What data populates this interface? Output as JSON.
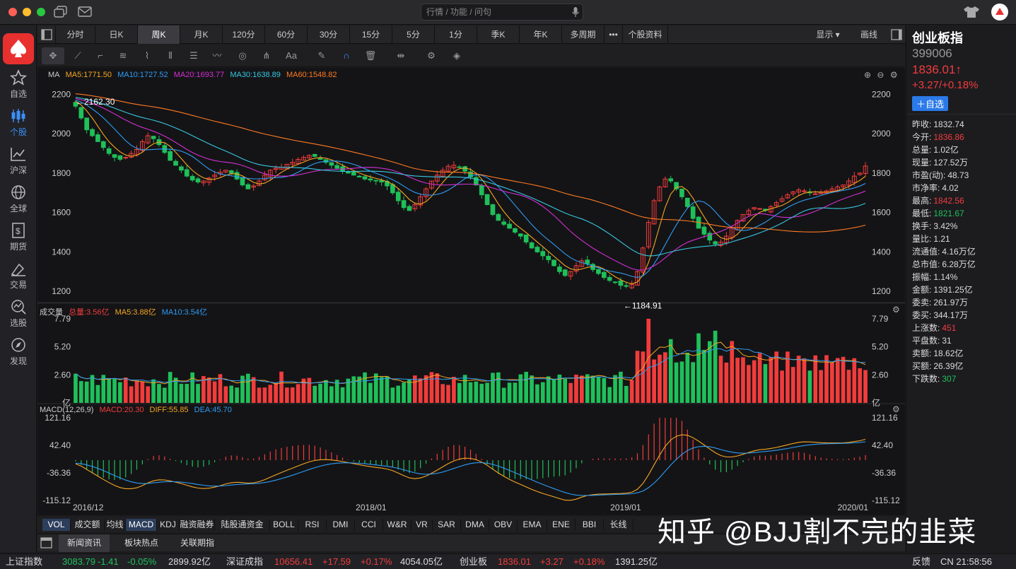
{
  "titlebar": {
    "search_placeholder": "行情 / 功能 / 问句"
  },
  "nav": [
    {
      "label": "自选",
      "icon": "star-icon"
    },
    {
      "label": "个股",
      "icon": "candlestick-icon",
      "active": true
    },
    {
      "label": "沪深",
      "icon": "line-chart-icon"
    },
    {
      "label": "全球",
      "icon": "globe-icon"
    },
    {
      "label": "期货",
      "icon": "futures-icon"
    },
    {
      "label": "交易",
      "icon": "trade-icon"
    },
    {
      "label": "选股",
      "icon": "stock-picker-icon"
    },
    {
      "label": "发现",
      "icon": "compass-icon"
    }
  ],
  "periods": [
    "分时",
    "日K",
    "周K",
    "月K",
    "120分",
    "60分",
    "30分",
    "15分",
    "5分",
    "1分",
    "季K",
    "年K",
    "多周期",
    "•••",
    "个股资料"
  ],
  "active_period": "周K",
  "period_right": {
    "display": "显示",
    "draw": "画线"
  },
  "main_legend": {
    "name": "MA",
    "ma5": "MA5:1771.50",
    "ma10": "MA10:1727.52",
    "ma20": "MA20:1693.77",
    "ma30": "MA30:1638.89",
    "ma60": "MA60:1548.82"
  },
  "vol_legend": {
    "name": "成交量",
    "total": "总量:3.56亿",
    "ma5": "MA5:3.88亿",
    "ma10": "MA10:3.54亿"
  },
  "macd_legend": {
    "name": "MACD(12,26,9)",
    "macd": "MACD:20.30",
    "diff": "DIFF:55.85",
    "dea": "DEA:45.70"
  },
  "annotations": {
    "high": "←2162.30",
    "low": "←1184.91"
  },
  "price_ticks": [
    "2200",
    "2000",
    "1800",
    "1600",
    "1400",
    "1200"
  ],
  "vol_ticks": [
    "7.79",
    "5.20",
    "2.60",
    "亿"
  ],
  "macd_ticks": [
    "121.16",
    "42.40",
    "-36.36",
    "-115.12"
  ],
  "date_labels": [
    "2016/12",
    "2018/01",
    "2019/01",
    "2020/01"
  ],
  "indicators": [
    "VOL",
    "成交额",
    "均线",
    "MACD",
    "KDJ",
    "融资融券",
    "陆股通资金",
    "BOLL",
    "RSI",
    "DMI",
    "CCI",
    "W&R",
    "VR",
    "SAR",
    "DMA",
    "OBV",
    "EMA",
    "ENE",
    "BBI",
    "长线"
  ],
  "active_indicators": [
    "VOL",
    "MACD"
  ],
  "news_tabs": [
    "新闻资讯",
    "板块热点",
    "关联期指"
  ],
  "stock": {
    "name": "创业板指",
    "code": "399006",
    "price": "1836.01↑",
    "change": "+3.27/+0.18%",
    "add_watch": "＋自选"
  },
  "stats": [
    {
      "k": "昨收:",
      "v": "1832.74",
      "c": "n"
    },
    {
      "k": "今开:",
      "v": "1836.86",
      "c": "r"
    },
    {
      "k": "总量:",
      "v": "1.02亿",
      "c": "n"
    },
    {
      "k": "现量:",
      "v": "127.52万",
      "c": "n"
    },
    {
      "k": "市盈(动):",
      "v": "48.73",
      "c": "n"
    },
    {
      "k": "市净率:",
      "v": "4.02",
      "c": "n"
    },
    {
      "k": "最高:",
      "v": "1842.56",
      "c": "r"
    },
    {
      "k": "最低:",
      "v": "1821.67",
      "c": "g"
    },
    {
      "k": "换手:",
      "v": "3.42%",
      "c": "n"
    },
    {
      "k": "量比:",
      "v": "1.21",
      "c": "n"
    },
    {
      "k": "流通值:",
      "v": "4.16万亿",
      "c": "n"
    },
    {
      "k": "总市值:",
      "v": "6.28万亿",
      "c": "n"
    },
    {
      "k": "振幅:",
      "v": "1.14%",
      "c": "n"
    },
    {
      "k": "金额:",
      "v": "1391.25亿",
      "c": "n"
    },
    {
      "k": "委卖:",
      "v": "261.97万",
      "c": "n"
    },
    {
      "k": "委买:",
      "v": "344.17万",
      "c": "n"
    },
    {
      "k": "上涨数:",
      "v": "451",
      "c": "r"
    },
    {
      "k": "平盘数:",
      "v": "31",
      "c": "n"
    },
    {
      "k": "卖额:",
      "v": "18.62亿",
      "c": "n"
    },
    {
      "k": "买额:",
      "v": "26.39亿",
      "c": "n"
    },
    {
      "k": "下跌数:",
      "v": "307",
      "c": "g"
    }
  ],
  "statusbar": {
    "sh": {
      "name": "上证指数",
      "price": "3083.79",
      "chg": "-1.41",
      "pct": "-0.05%",
      "amt": "2899.92亿"
    },
    "sz": {
      "name": "深证成指",
      "price": "10656.41",
      "chg": "+17.59",
      "pct": "+0.17%",
      "amt": "4054.05亿"
    },
    "cy": {
      "name": "创业板",
      "price": "1836.01",
      "chg": "+3.27",
      "pct": "+0.18%",
      "amt": "1391.25亿"
    },
    "feedback": "反馈",
    "clock": "CN 21:58:56"
  },
  "watermark": "知乎 @BJJ割不完的韭菜",
  "colors": {
    "up": "#f23c3c",
    "down": "#1fc05a",
    "ma5": "#f5a623",
    "ma10": "#2f9cf5",
    "ma20": "#d22fd2",
    "ma30": "#38c6e0",
    "ma60": "#ff7a22"
  },
  "chart_data": {
    "type": "candlestick",
    "title": "创业板指 周K",
    "ylim": [
      1150,
      2270
    ],
    "series_close": [
      2140,
      2080,
      2020,
      1990,
      1960,
      1930,
      1900,
      1880,
      1870,
      1880,
      1900,
      1920,
      1960,
      1990,
      1975,
      1945,
      1905,
      1865,
      1840,
      1815,
      1785,
      1765,
      1755,
      1760,
      1775,
      1790,
      1805,
      1815,
      1800,
      1770,
      1740,
      1720,
      1735,
      1760,
      1790,
      1815,
      1825,
      1830,
      1845,
      1855,
      1870,
      1880,
      1890,
      1885,
      1870,
      1855,
      1840,
      1825,
      1810,
      1800,
      1790,
      1780,
      1770,
      1765,
      1760,
      1755,
      1735,
      1700,
      1660,
      1625,
      1610,
      1640,
      1680,
      1720,
      1760,
      1790,
      1815,
      1835,
      1840,
      1830,
      1810,
      1780,
      1740,
      1690,
      1640,
      1590,
      1560,
      1540,
      1520,
      1500,
      1480,
      1450,
      1420,
      1400,
      1380,
      1360,
      1330,
      1300,
      1280,
      1300,
      1330,
      1355,
      1340,
      1310,
      1290,
      1270,
      1255,
      1245,
      1230,
      1225,
      1235,
      1300,
      1420,
      1550,
      1660,
      1730,
      1770,
      1760,
      1720,
      1680,
      1630,
      1570,
      1520,
      1490,
      1460,
      1440,
      1450,
      1480,
      1520,
      1560,
      1590,
      1610,
      1625,
      1620,
      1610,
      1630,
      1650,
      1670,
      1690,
      1705,
      1715,
      1710,
      1700,
      1695,
      1700,
      1710,
      1720,
      1730,
      1740,
      1760,
      1785,
      1800,
      1836
    ],
    "vol_ylim": [
      0,
      7.79
    ],
    "macd_ylim": [
      -115.12,
      121.16
    ]
  }
}
